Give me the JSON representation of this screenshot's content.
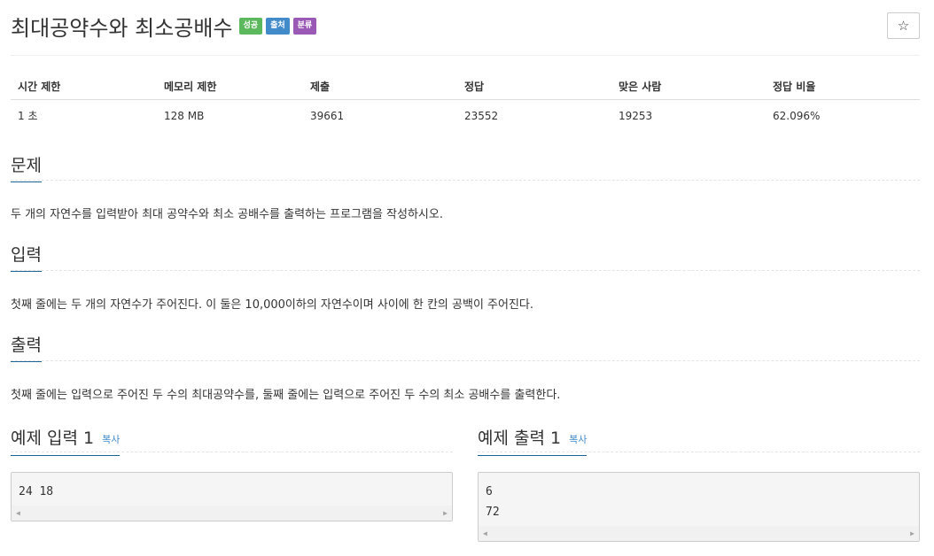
{
  "problem": {
    "title": "최대공약수와 최소공배수",
    "labels": {
      "success": "성공",
      "source": "출처",
      "category": "분류"
    },
    "star_icon": "star-icon"
  },
  "info_table": {
    "headers": [
      "시간 제한",
      "메모리 제한",
      "제출",
      "정답",
      "맞은 사람",
      "정답 비율"
    ],
    "values": [
      "1 초",
      "128 MB",
      "39661",
      "23552",
      "19253",
      "62.096%"
    ]
  },
  "sections": {
    "description": {
      "heading": "문제",
      "text": "두 개의 자연수를 입력받아 최대 공약수와 최소 공배수를 출력하는 프로그램을 작성하시오."
    },
    "input": {
      "heading": "입력",
      "text": "첫째 줄에는 두 개의 자연수가 주어진다. 이 둘은 10,000이하의 자연수이며 사이에 한 칸의 공백이 주어진다."
    },
    "output": {
      "heading": "출력",
      "text": "첫째 줄에는 입력으로 주어진 두 수의 최대공약수를, 둘째 줄에는 입력으로 주어진 두 수의 최소 공배수를 출력한다."
    }
  },
  "samples": {
    "input": {
      "heading": "예제 입력 1",
      "copy_label": "복사",
      "content": "24 18"
    },
    "output": {
      "heading": "예제 출력 1",
      "copy_label": "복사",
      "line1": "6",
      "line2": "72"
    }
  },
  "colors": {
    "success": "#5cb85c",
    "info": "#428bca",
    "category": "#9b59b6",
    "link": "#428bca"
  }
}
